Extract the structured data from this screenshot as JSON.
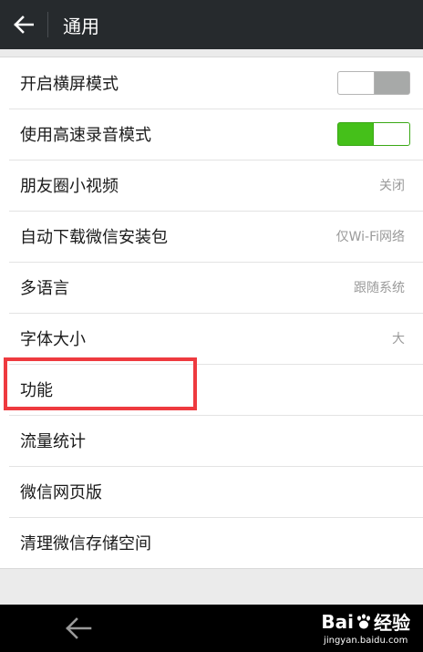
{
  "header": {
    "title": "通用",
    "back_icon": "arrow-left-icon"
  },
  "settings": [
    {
      "id": "landscape",
      "label": "开启横屏模式",
      "type": "toggle",
      "on": false
    },
    {
      "id": "hq-audio",
      "label": "使用高速录音模式",
      "type": "toggle",
      "on": true
    },
    {
      "id": "moments-video",
      "label": "朋友圈小视频",
      "type": "value",
      "value": "关闭"
    },
    {
      "id": "auto-download",
      "label": "自动下载微信安装包",
      "type": "value",
      "value": "仅Wi-Fi网络"
    },
    {
      "id": "language",
      "label": "多语言",
      "type": "value",
      "value": "跟随系统"
    },
    {
      "id": "font-size",
      "label": "字体大小",
      "type": "value",
      "value": "大"
    },
    {
      "id": "features",
      "label": "功能",
      "type": "link"
    },
    {
      "id": "traffic",
      "label": "流量统计",
      "type": "link"
    },
    {
      "id": "web-version",
      "label": "微信网页版",
      "type": "link"
    },
    {
      "id": "clear-storage",
      "label": "清理微信存储空间",
      "type": "link"
    }
  ],
  "annotation": {
    "highlight_color": "#ee3a3f",
    "highlighted_item": "功能"
  },
  "navbar": {
    "back_icon": "arrow-left-icon"
  },
  "watermark": {
    "brand_left": "Bai",
    "brand_right": "经验",
    "url": "jingyan.baidu.com"
  },
  "colors": {
    "toolbar_bg": "#262a2d",
    "toggle_on": "#45c01a",
    "toggle_off": "#a7a9a8"
  }
}
